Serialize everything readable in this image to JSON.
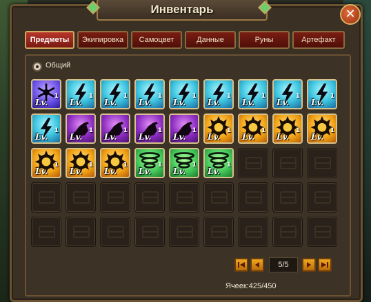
{
  "window": {
    "title": "Инвентарь",
    "close_symbol": "✕"
  },
  "tabs": [
    {
      "label": "Предметы",
      "active": true
    },
    {
      "label": "Экипировка",
      "active": false
    },
    {
      "label": "Самоцвет",
      "active": false
    },
    {
      "label": "Данные",
      "active": false
    },
    {
      "label": "Руны",
      "active": false
    },
    {
      "label": "Артефакт",
      "active": false
    }
  ],
  "filter": {
    "label": "Общий",
    "selected": true
  },
  "inventory": {
    "level_text": "Lv.",
    "items": [
      {
        "type": "frost",
        "icon": "snowflake-icon",
        "level": "1"
      },
      {
        "type": "lightning",
        "icon": "lightning-icon",
        "level": "1"
      },
      {
        "type": "lightning",
        "icon": "lightning-icon",
        "level": "1"
      },
      {
        "type": "lightning",
        "icon": "lightning-icon",
        "level": "1"
      },
      {
        "type": "lightning",
        "icon": "lightning-icon",
        "level": "1"
      },
      {
        "type": "lightning",
        "icon": "lightning-icon",
        "level": "1"
      },
      {
        "type": "lightning",
        "icon": "lightning-icon",
        "level": "1"
      },
      {
        "type": "lightning",
        "icon": "lightning-icon",
        "level": "1"
      },
      {
        "type": "lightning",
        "icon": "lightning-icon",
        "level": "1"
      },
      {
        "type": "lightning",
        "icon": "lightning-icon",
        "level": "1"
      },
      {
        "type": "raven",
        "icon": "raven-icon",
        "level": "1"
      },
      {
        "type": "raven",
        "icon": "raven-icon",
        "level": "1"
      },
      {
        "type": "raven",
        "icon": "raven-icon",
        "level": "1"
      },
      {
        "type": "raven",
        "icon": "raven-icon",
        "level": "1"
      },
      {
        "type": "sun",
        "icon": "sun-ring-icon",
        "level": "1"
      },
      {
        "type": "sun",
        "icon": "sun-ring-icon",
        "level": "1"
      },
      {
        "type": "sun",
        "icon": "sun-ring-icon",
        "level": "1"
      },
      {
        "type": "sun",
        "icon": "sun-ring-icon",
        "level": "1"
      },
      {
        "type": "sun",
        "icon": "sun-ring-icon",
        "level": "1"
      },
      {
        "type": "sun",
        "icon": "sun-ring-icon",
        "level": "1"
      },
      {
        "type": "sun",
        "icon": "sun-ring-icon",
        "level": "1"
      },
      {
        "type": "whirl",
        "icon": "whirlwind-icon",
        "level": "1"
      },
      {
        "type": "whirl",
        "icon": "whirlwind-icon",
        "level": "1"
      },
      {
        "type": "whirl",
        "icon": "whirlwind-icon",
        "level": "1"
      }
    ],
    "empty_slot_icon": "chest-icon",
    "total_slots": 45
  },
  "pagination": {
    "first_icon": "first-page-icon",
    "prev_icon": "prev-page-icon",
    "next_icon": "next-page-icon",
    "last_icon": "last-page-icon",
    "page_text": "5/5"
  },
  "cells_text": "Ячеек:425/450",
  "colors": {
    "frame_gold": "#c7a763",
    "tab_red": "#7a1d12",
    "button_orange": "#f0a820"
  }
}
